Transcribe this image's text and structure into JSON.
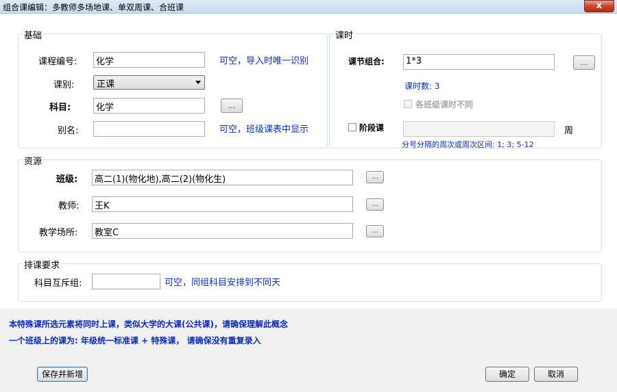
{
  "window": {
    "title": "组合课编辑：多教师多场地课、单双周课、合班课",
    "close_glyph": "x"
  },
  "basic": {
    "group_label": "基础",
    "course_code_label": "课程编号:",
    "course_code_value": "化学",
    "course_code_hint": "可空，导入时唯一识别",
    "category_label": "课别:",
    "category_value": "正课",
    "subject_label": "科目:",
    "subject_value": "化学",
    "alias_label": "别名:",
    "alias_value": "",
    "alias_hint": "可空，班级课表中显示"
  },
  "periods": {
    "group_label": "课时",
    "combo_label": "课节组合:",
    "combo_value": "1*3",
    "count_text": "课时数: 3",
    "diff_class_label": "各班级课时不同",
    "stage_label": "阶段课",
    "stage_value": "",
    "week_unit": "周",
    "week_hint": "分号分隔的周次或周次区间: 1; 3; 5-12"
  },
  "resources": {
    "group_label": "资源",
    "class_label": "班级:",
    "class_value": "高二(1)(物化地),高二(2)(物化生)",
    "teacher_label": "教师:",
    "teacher_value": "王K",
    "venue_label": "教学场所:",
    "venue_value": "教室C"
  },
  "requirements": {
    "group_label": "排课要求",
    "mutex_label": "科目互斥组:",
    "mutex_value": "",
    "mutex_hint": "可空，同组科目安排到不同天"
  },
  "notes": [
    "本特殊课所选元素将同时上课，类似大学的大课(公共课)，请确保理解此概念",
    "一个班级上的课为: 年级统一标准课 + 特殊课， 请确保没有重复录入"
  ],
  "buttons": {
    "dots": "...",
    "save_new": "保存并新增",
    "ok": "确定",
    "cancel": "取消"
  }
}
